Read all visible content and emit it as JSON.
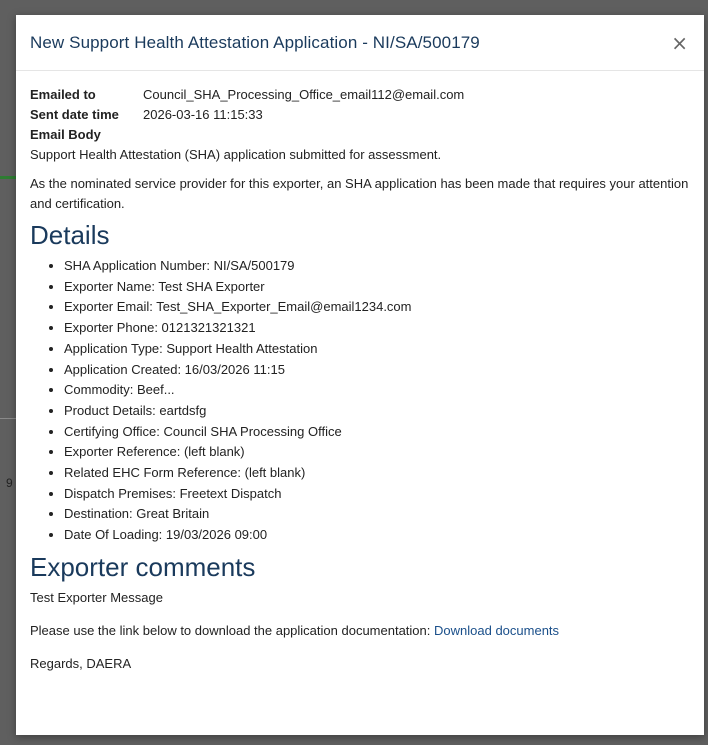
{
  "modal": {
    "title": "New Support Health Attestation Application - NI/SA/500179",
    "close_glyph": "×"
  },
  "email": {
    "emailed_to_label": "Emailed to",
    "emailed_to_value": "Council_SHA_Processing_Office_email112@email.com",
    "sent_label": "Sent date time",
    "sent_value": "2026-03-16 11:15:33",
    "body_label": "Email Body"
  },
  "body": {
    "intro": "Support Health Attestation (SHA) application submitted for assessment.",
    "nominated": "As the nominated service provider for this exporter, an SHA application has been made that requires your attention and certification.",
    "details_heading": "Details",
    "details": [
      "SHA Application Number: NI/SA/500179",
      "Exporter Name: Test SHA Exporter",
      "Exporter Email: Test_SHA_Exporter_Email@email1234.com",
      "Exporter Phone: 0121321321321",
      "Application Type: Support Health Attestation",
      "Application Created: 16/03/2026 11:15",
      "Commodity: Beef...",
      "Product Details: eartdsfg",
      "Certifying Office: Council SHA Processing Office",
      "Exporter Reference: (left blank)",
      "Related EHC Form Reference: (left blank)",
      "Dispatch Premises: Freetext Dispatch",
      "Destination: Great Britain",
      "Date Of Loading: 19/03/2026 09:00"
    ],
    "comments_heading": "Exporter comments",
    "comment_text": "Test Exporter Message",
    "download_text": "Please use the link below to download the application documentation:",
    "download_link": "Download documents",
    "signoff": "Regards, DAERA"
  },
  "background": {
    "partial_char": "9"
  }
}
